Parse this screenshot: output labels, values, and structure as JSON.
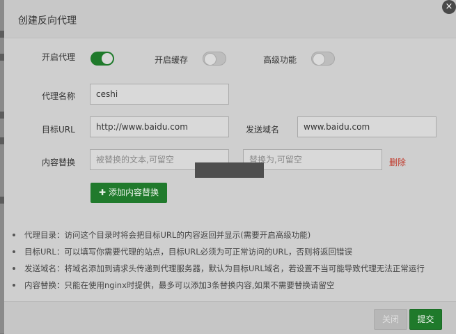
{
  "dialog": {
    "title": "创建反向代理",
    "close_symbol": "×"
  },
  "toggles": {
    "proxy": {
      "label": "开启代理",
      "on": true
    },
    "cache": {
      "label": "开启缓存",
      "on": false
    },
    "advanced": {
      "label": "高级功能",
      "on": false
    }
  },
  "form": {
    "name_label": "代理名称",
    "name_value": "ceshi",
    "target_label": "目标URL",
    "target_value": "http://www.baidu.com",
    "send_domain_label": "发送域名",
    "send_domain_value": "www.baidu.com",
    "replace_label": "内容替换",
    "replace_from_placeholder": "被替换的文本,可留空",
    "replace_to_placeholder": "替换为,可留空",
    "delete_label": "删除",
    "add_button_label": "添加内容替换",
    "add_icon": "plus-icon"
  },
  "tips": [
    "代理目录：访问这个目录时将会把目标URL的内容返回并显示(需要开启高级功能)",
    "目标URL：可以填写你需要代理的站点，目标URL必须为可正常访问的URL，否则将返回错误",
    "发送域名：将域名添加到请求头传递到代理服务器，默认为目标URL域名，若设置不当可能导致代理无法正常运行",
    "内容替换：只能在使用nginx时提供，最多可以添加3条替换内容,如果不需要替换请留空"
  ],
  "footer": {
    "close_label": "关闭",
    "submit_label": "提交"
  },
  "colors": {
    "primary": "#1f7a2b",
    "danger": "#c0392b"
  }
}
